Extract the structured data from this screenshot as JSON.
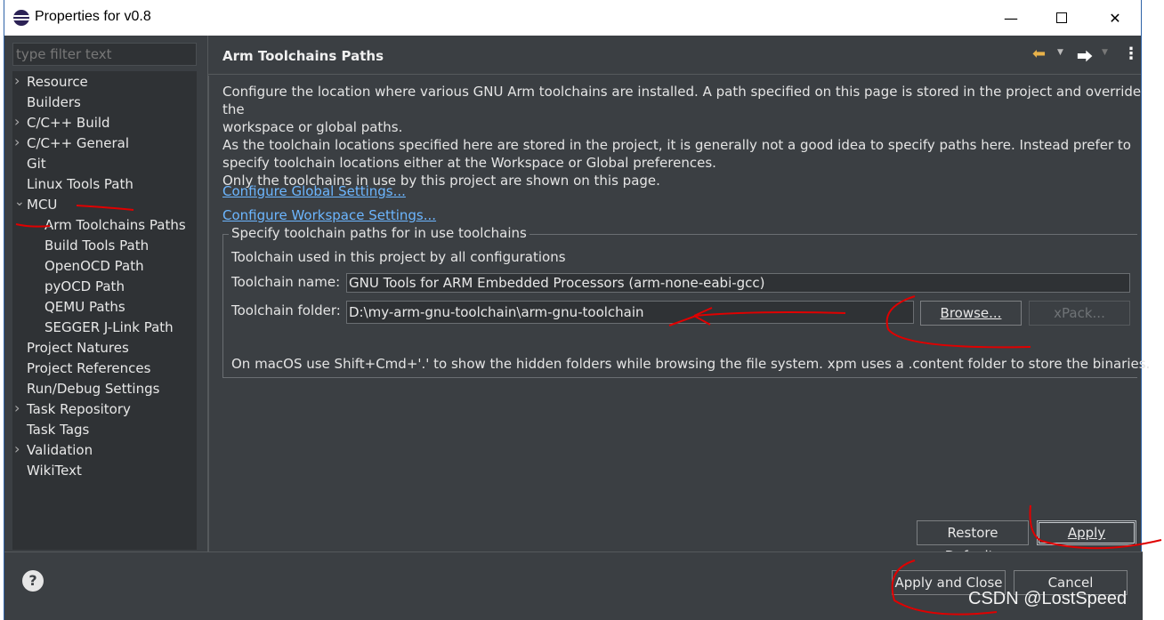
{
  "window": {
    "title": "Properties for v0.8"
  },
  "filter": {
    "placeholder": "type filter text"
  },
  "tree": [
    {
      "label": "Resource",
      "expandable": true,
      "expanded": false,
      "indent": 0
    },
    {
      "label": "Builders",
      "expandable": false,
      "indent": 0
    },
    {
      "label": "C/C++ Build",
      "expandable": true,
      "expanded": false,
      "indent": 0
    },
    {
      "label": "C/C++ General",
      "expandable": true,
      "expanded": false,
      "indent": 0
    },
    {
      "label": "Git",
      "expandable": false,
      "indent": 0
    },
    {
      "label": "Linux Tools Path",
      "expandable": false,
      "indent": 0
    },
    {
      "label": "MCU",
      "expandable": true,
      "expanded": true,
      "indent": 0
    },
    {
      "label": "Arm Toolchains Paths",
      "expandable": false,
      "indent": 1,
      "selected": true
    },
    {
      "label": "Build Tools Path",
      "expandable": false,
      "indent": 1
    },
    {
      "label": "OpenOCD Path",
      "expandable": false,
      "indent": 1
    },
    {
      "label": "pyOCD Path",
      "expandable": false,
      "indent": 1
    },
    {
      "label": "QEMU Paths",
      "expandable": false,
      "indent": 1
    },
    {
      "label": "SEGGER J-Link Path",
      "expandable": false,
      "indent": 1
    },
    {
      "label": "Project Natures",
      "expandable": false,
      "indent": 0
    },
    {
      "label": "Project References",
      "expandable": false,
      "indent": 0
    },
    {
      "label": "Run/Debug Settings",
      "expandable": false,
      "indent": 0
    },
    {
      "label": "Task Repository",
      "expandable": true,
      "expanded": false,
      "indent": 0
    },
    {
      "label": "Task Tags",
      "expandable": false,
      "indent": 0
    },
    {
      "label": "Validation",
      "expandable": true,
      "expanded": false,
      "indent": 0
    },
    {
      "label": "WikiText",
      "expandable": false,
      "indent": 0
    }
  ],
  "page": {
    "title": "Arm Toolchains Paths",
    "description": [
      "Configure the location where various GNU Arm toolchains are installed. A path specified on this page is stored in the project and override the",
      "workspace or global paths.",
      "As the toolchain locations specified here are stored in the project, it is generally not a good idea to specify paths here. Instead prefer to",
      "specify toolchain locations either at the Workspace or Global preferences.",
      "Only the toolchains in use by this project are shown on this page."
    ],
    "link_global": "Configure Global Settings...",
    "link_workspace": "Configure Workspace Settings...",
    "group_title": "Specify toolchain paths for in use toolchains",
    "group_subtitle": "Toolchain used in this project by all configurations",
    "toolchain_name_label": "Toolchain name:",
    "toolchain_name_value": "GNU Tools for ARM Embedded Processors (arm-none-eabi-gcc)",
    "toolchain_folder_label": "Toolchain folder:",
    "toolchain_folder_value": "D:\\my-arm-gnu-toolchain\\arm-gnu-toolchain",
    "browse_label": "Browse...",
    "xpack_label": "xPack...",
    "note": "On macOS use Shift+Cmd+'.' to show the hidden folders while browsing the file system. xpm uses a .content folder to store the binaries.",
    "restore_defaults_label": "Restore Defaults",
    "apply_label": "Apply"
  },
  "footer": {
    "help_symbol": "?",
    "apply_close_label": "Apply and Close",
    "cancel_label": "Cancel"
  },
  "watermark": "CSDN @LostSpeed",
  "colors": {
    "panel": "#3b3f43",
    "tree_bg": "#2f3235",
    "link": "#6cb6ff",
    "annotation": "#e00000",
    "nav_arrow_back": "#e8b24a"
  },
  "icons": {
    "back": "arrow-left-icon",
    "forward": "arrow-right-icon",
    "menu": "vertical-dots-icon",
    "help": "help-icon"
  }
}
